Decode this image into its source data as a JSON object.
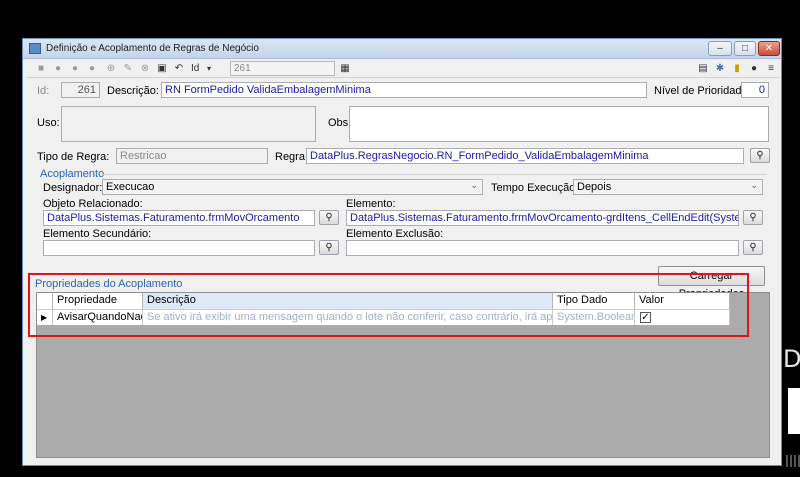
{
  "window": {
    "title": "Definição e Acoplamento de Regras de Negócio",
    "controls": {
      "minimize": "–",
      "maximize": "□",
      "close": "✕"
    }
  },
  "toolbar": {
    "id_label": "Id",
    "id_value": "261"
  },
  "form": {
    "id_label": "Id:",
    "id_value": "261",
    "descricao_label": "Descrição:",
    "descricao_value": "RN FormPedido ValidaEmbalagemMinima",
    "prioridade_label": "Nível de Prioridade:",
    "prioridade_value": "0",
    "uso_label": "Uso:",
    "uso_value": "",
    "obs_label": "Obs:",
    "obs_value": "",
    "tipo_label": "Tipo de Regra:",
    "tipo_value": "Restricao",
    "regra_label": "Regra:",
    "regra_value": "DataPlus.RegrasNegocio.RN_FormPedido_ValidaEmbalagemMinima"
  },
  "acoplamento": {
    "title": "Acoplamento",
    "designador_label": "Designador:",
    "designador_value": "Execucao",
    "tempo_label": "Tempo Execução:",
    "tempo_value": "Depois",
    "objeto_label": "Objeto Relacionado:",
    "objeto_value": "DataPlus.Sistemas.Faturamento.frmMovOrcamento",
    "elemento_label": "Elemento:",
    "elemento_value": "DataPlus.Sistemas.Faturamento.frmMovOrcamento-grdItens_CellEndEdit(System.Object,System",
    "secundario_label": "Elemento Secundário:",
    "secundario_value": "",
    "exclusao_label": "Elemento Exclusão:",
    "exclusao_value": ""
  },
  "propriedades": {
    "title": "Propriedades do Acoplamento",
    "load_button": "Carregar Propriedades",
    "columns": [
      "Propriedade",
      "Descrição",
      "Tipo Dado",
      "Valor"
    ],
    "rows": [
      {
        "propriedade": "AvisarQuandoNao...",
        "descricao": "Se ativo irá exibir uma mensagem quando o lote não conferir, caso contrário, irá apenas sobrepor",
        "tipo": "System.Boolean",
        "valor": true
      }
    ]
  },
  "background": {
    "partial_text": "D"
  },
  "colors": {
    "accent": "#2d62b4",
    "highlight": "#e01515",
    "link_text": "#1a1aa6"
  }
}
